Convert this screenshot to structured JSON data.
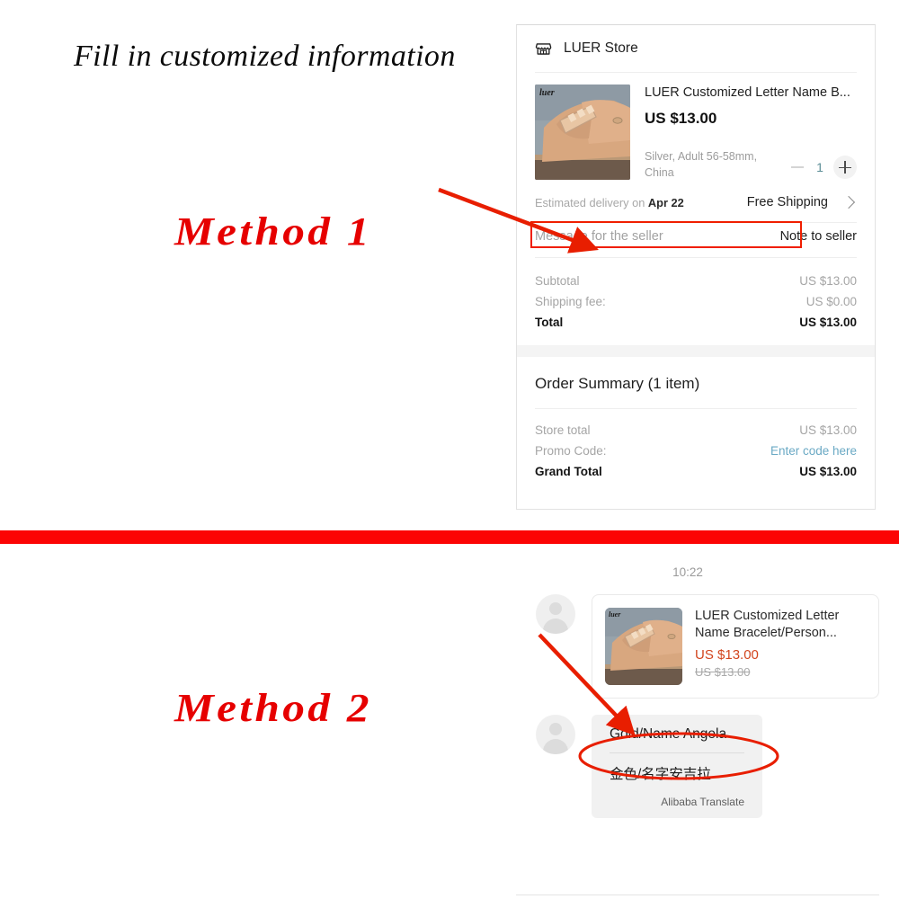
{
  "promo": {
    "title": "Fill in customized information",
    "method_1_label": "Method 1",
    "method_2_label": "Method 2",
    "accent_color": "#e60000",
    "divider_color": "#fc0404",
    "highlight_color": "#f01e00"
  },
  "checkout": {
    "store": {
      "icon": "storefront-icon",
      "name": "LUER Store"
    },
    "product": {
      "title": "LUER Customized Letter Name B...",
      "price": "US $13.00",
      "variant": "Silver, Adult 56-58mm, China",
      "quantity": "1",
      "minus_label": "minus-icon",
      "plus_label": "plus-icon"
    },
    "delivery": {
      "prefix": "Estimated delivery on ",
      "date": "Apr 22",
      "shipping": "Free Shipping",
      "chevron": "chevron-right-icon"
    },
    "message": {
      "placeholder": "Message for the seller",
      "action": "Note to seller"
    },
    "totals": [
      {
        "label": "Subtotal",
        "value": "US $13.00",
        "strong": false,
        "link": false
      },
      {
        "label": "Shipping fee:",
        "value": "US $0.00",
        "strong": false,
        "link": false
      },
      {
        "label": "Total",
        "value": "US $13.00",
        "strong": true,
        "link": false
      }
    ],
    "summary": {
      "title": "Order Summary (1 item)",
      "lines": [
        {
          "label": "Store total",
          "value": "US $13.00",
          "strong": false,
          "link": false
        },
        {
          "label": "Promo Code:",
          "value": "Enter code here",
          "strong": false,
          "link": true
        },
        {
          "label": "Grand Total",
          "value": "US $13.00",
          "strong": true,
          "link": false
        }
      ]
    }
  },
  "chat": {
    "timestamp": "10:22",
    "avatar_icon": "user-avatar-icon",
    "product_card": {
      "title": "LUER Customized Letter Name Bracelet/Person...",
      "price": "US $13.00",
      "price_original": "US $13.00",
      "price_color": "#d2451e"
    },
    "message": {
      "text": "Gold/Name Angela",
      "translation": "金色/名字安吉拉",
      "source": "Alibaba Translate"
    }
  }
}
